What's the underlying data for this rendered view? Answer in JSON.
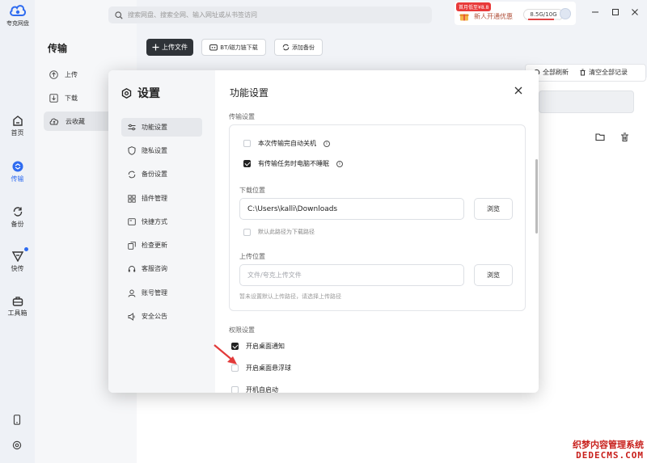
{
  "app": {
    "name": "夸克网盘"
  },
  "rail": [
    {
      "label": "首页",
      "icon": "home-icon"
    },
    {
      "label": "传输",
      "icon": "transfer-icon",
      "active": true
    },
    {
      "label": "备份",
      "icon": "backup-icon"
    },
    {
      "label": "快传",
      "icon": "fast-send-icon"
    },
    {
      "label": "工具箱",
      "icon": "toolbox-icon"
    }
  ],
  "subnav": {
    "title": "传输",
    "items": [
      {
        "label": "上传",
        "icon": "upload-icon"
      },
      {
        "label": "下载",
        "icon": "download-icon"
      },
      {
        "label": "云收藏",
        "icon": "cloud-save-icon",
        "active": true
      }
    ]
  },
  "search": {
    "placeholder": "搜索网盘、搜索全网、输入网址或从书签访问"
  },
  "promo": {
    "tag": "首月低至¥8.8",
    "text": "新人开通优惠",
    "quota": "8.5G/10G",
    "usage_fraction": 0.85
  },
  "toolbar": {
    "upload": "上传文件",
    "bt": "BT/磁力链下载",
    "add_backup": "添加备份"
  },
  "background": {
    "refresh_all": "全部刷新",
    "clear_all": "清空全部记录"
  },
  "settings": {
    "title": "设置",
    "menu": [
      {
        "label": "功能设置",
        "icon": "sliders-icon",
        "active": true
      },
      {
        "label": "隐私设置",
        "icon": "shield-icon"
      },
      {
        "label": "备份设置",
        "icon": "sync-icon"
      },
      {
        "label": "插件管理",
        "icon": "grid-icon"
      },
      {
        "label": "快捷方式",
        "icon": "shortcut-icon"
      },
      {
        "label": "检查更新",
        "icon": "update-icon"
      },
      {
        "label": "客服咨询",
        "icon": "headset-icon"
      },
      {
        "label": "账号管理",
        "icon": "account-icon"
      },
      {
        "label": "安全公告",
        "icon": "speaker-icon"
      }
    ],
    "panel_title": "功能设置",
    "transfer_section": "传输设置",
    "auto_shutdown": {
      "label": "本次传输完自动关机",
      "checked": false
    },
    "no_sleep": {
      "label": "有传输任务时电脑不睡眠",
      "checked": true
    },
    "download_location_label": "下载位置",
    "download_path": "C:\\Users\\kalli\\Downloads",
    "browse": "浏览",
    "default_download": {
      "label": "默认此路径为下载路径",
      "checked": false
    },
    "upload_location_label": "上传位置",
    "upload_placeholder": "文件/夸克上传文件",
    "upload_hint": "暂未设置默认上传路径，请选择上传路径",
    "permission_section": "权限设置",
    "desktop_notify": {
      "label": "开启桌面通知",
      "checked": true
    },
    "float_ball": {
      "label": "开启桌面悬浮球",
      "checked": false
    },
    "autostart": {
      "label": "开机自启动",
      "checked": false
    }
  },
  "watermark": {
    "line1": "织梦内容管理系统",
    "line2": "DEDECMS.COM"
  },
  "colors": {
    "accent": "#2e6bf0",
    "dark_button": "#2f3338",
    "annotation_arrow": "#e23a3a"
  }
}
